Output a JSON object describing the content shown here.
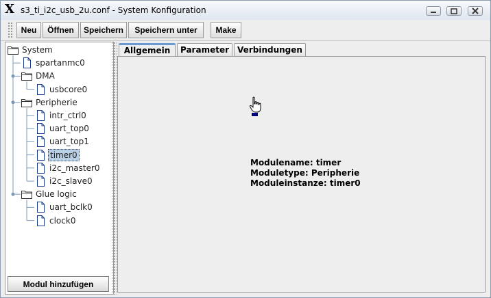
{
  "window": {
    "title": "s3_ti_i2c_usb_2u.conf - System Konfiguration",
    "logo_glyph": "X",
    "buttons": [
      "minimize-icon",
      "maximize-icon",
      "close-icon"
    ]
  },
  "toolbar": {
    "new_label": "Neu",
    "open_label": "Öffnen",
    "save_label": "Speichern",
    "save_as_label": "Speichern unter",
    "make_label": "Make"
  },
  "tree": {
    "root": "System",
    "items": [
      {
        "label": "spartanmc0",
        "type": "file"
      },
      {
        "label": "DMA",
        "type": "folder"
      },
      {
        "label": "usbcore0",
        "type": "file"
      },
      {
        "label": "Peripherie",
        "type": "folder"
      },
      {
        "label": "intr_ctrl0",
        "type": "file"
      },
      {
        "label": "uart_top0",
        "type": "file"
      },
      {
        "label": "uart_top1",
        "type": "file"
      },
      {
        "label": "timer0",
        "type": "file",
        "selected": true
      },
      {
        "label": "i2c_master0",
        "type": "file"
      },
      {
        "label": "i2c_slave0",
        "type": "file"
      },
      {
        "label": "Glue logic",
        "type": "folder"
      },
      {
        "label": "uart_bclk0",
        "type": "file"
      },
      {
        "label": "clock0",
        "type": "file"
      }
    ],
    "add_button_label": "Modul hinzufügen"
  },
  "tabs": {
    "general": "Allgemein",
    "parameters": "Parameter",
    "connections": "Verbindungen",
    "active": "Allgemein"
  },
  "details": {
    "module_name": "Modulename: timer",
    "module_type": "Moduletype: Peripherie",
    "module_instance": "Moduleinstanze: timer0"
  },
  "colors": {
    "selection": "#b8cfe5",
    "active_tab_accent": "#6a9ad0",
    "title_gradient_top": "#f7f9fc"
  }
}
